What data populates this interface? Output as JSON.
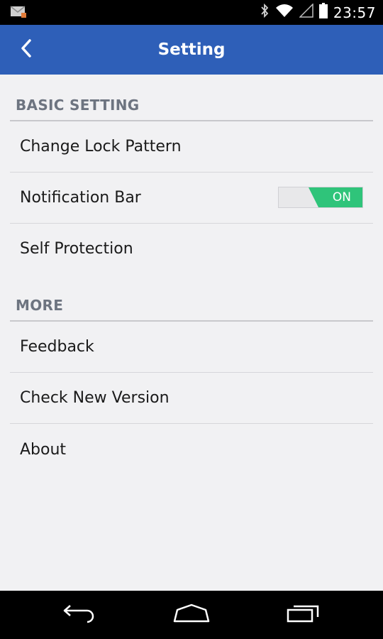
{
  "status_bar": {
    "time": "23:57",
    "icons": [
      "mail-notification-icon",
      "bluetooth-icon",
      "wifi-icon",
      "signal-icon",
      "battery-icon"
    ]
  },
  "app_bar": {
    "title": "Setting",
    "back_icon": "chevron-left-icon",
    "color": "#2e5fb8"
  },
  "sections": [
    {
      "header": "BASIC SETTING",
      "items": [
        {
          "label": "Change Lock Pattern"
        },
        {
          "label": "Notification Bar",
          "toggle": {
            "state": "on",
            "label": "ON",
            "color": "#2fc47a"
          }
        },
        {
          "label": "Self Protection"
        }
      ]
    },
    {
      "header": "MORE",
      "items": [
        {
          "label": "Feedback"
        },
        {
          "label": "Check New Version"
        },
        {
          "label": "About"
        }
      ]
    }
  ],
  "nav_bar": {
    "icons": [
      "back-nav-icon",
      "home-nav-icon",
      "recents-nav-icon"
    ]
  }
}
